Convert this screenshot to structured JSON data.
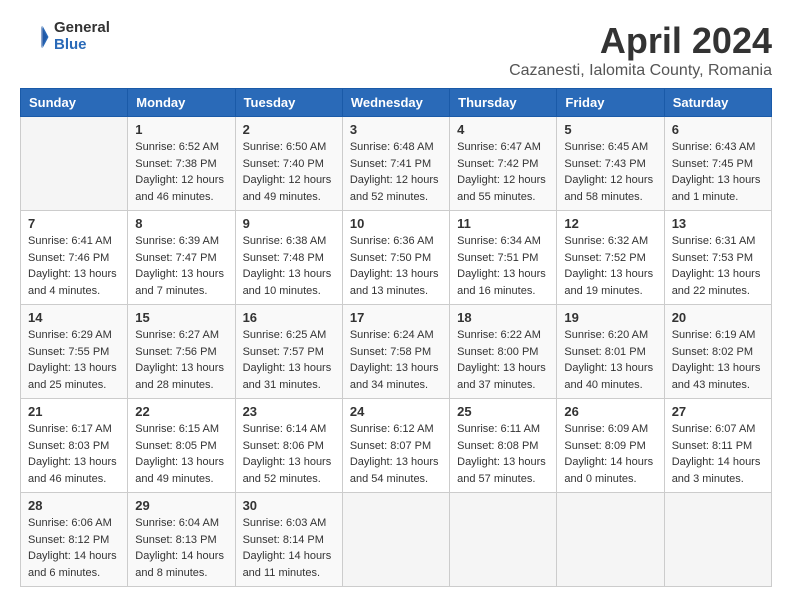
{
  "logo": {
    "general": "General",
    "blue": "Blue"
  },
  "title": "April 2024",
  "subtitle": "Cazanesti, Ialomita County, Romania",
  "days_of_week": [
    "Sunday",
    "Monday",
    "Tuesday",
    "Wednesday",
    "Thursday",
    "Friday",
    "Saturday"
  ],
  "weeks": [
    [
      {
        "day": "",
        "info": ""
      },
      {
        "day": "1",
        "info": "Sunrise: 6:52 AM\nSunset: 7:38 PM\nDaylight: 12 hours\nand 46 minutes."
      },
      {
        "day": "2",
        "info": "Sunrise: 6:50 AM\nSunset: 7:40 PM\nDaylight: 12 hours\nand 49 minutes."
      },
      {
        "day": "3",
        "info": "Sunrise: 6:48 AM\nSunset: 7:41 PM\nDaylight: 12 hours\nand 52 minutes."
      },
      {
        "day": "4",
        "info": "Sunrise: 6:47 AM\nSunset: 7:42 PM\nDaylight: 12 hours\nand 55 minutes."
      },
      {
        "day": "5",
        "info": "Sunrise: 6:45 AM\nSunset: 7:43 PM\nDaylight: 12 hours\nand 58 minutes."
      },
      {
        "day": "6",
        "info": "Sunrise: 6:43 AM\nSunset: 7:45 PM\nDaylight: 13 hours\nand 1 minute."
      }
    ],
    [
      {
        "day": "7",
        "info": "Sunrise: 6:41 AM\nSunset: 7:46 PM\nDaylight: 13 hours\nand 4 minutes."
      },
      {
        "day": "8",
        "info": "Sunrise: 6:39 AM\nSunset: 7:47 PM\nDaylight: 13 hours\nand 7 minutes."
      },
      {
        "day": "9",
        "info": "Sunrise: 6:38 AM\nSunset: 7:48 PM\nDaylight: 13 hours\nand 10 minutes."
      },
      {
        "day": "10",
        "info": "Sunrise: 6:36 AM\nSunset: 7:50 PM\nDaylight: 13 hours\nand 13 minutes."
      },
      {
        "day": "11",
        "info": "Sunrise: 6:34 AM\nSunset: 7:51 PM\nDaylight: 13 hours\nand 16 minutes."
      },
      {
        "day": "12",
        "info": "Sunrise: 6:32 AM\nSunset: 7:52 PM\nDaylight: 13 hours\nand 19 minutes."
      },
      {
        "day": "13",
        "info": "Sunrise: 6:31 AM\nSunset: 7:53 PM\nDaylight: 13 hours\nand 22 minutes."
      }
    ],
    [
      {
        "day": "14",
        "info": "Sunrise: 6:29 AM\nSunset: 7:55 PM\nDaylight: 13 hours\nand 25 minutes."
      },
      {
        "day": "15",
        "info": "Sunrise: 6:27 AM\nSunset: 7:56 PM\nDaylight: 13 hours\nand 28 minutes."
      },
      {
        "day": "16",
        "info": "Sunrise: 6:25 AM\nSunset: 7:57 PM\nDaylight: 13 hours\nand 31 minutes."
      },
      {
        "day": "17",
        "info": "Sunrise: 6:24 AM\nSunset: 7:58 PM\nDaylight: 13 hours\nand 34 minutes."
      },
      {
        "day": "18",
        "info": "Sunrise: 6:22 AM\nSunset: 8:00 PM\nDaylight: 13 hours\nand 37 minutes."
      },
      {
        "day": "19",
        "info": "Sunrise: 6:20 AM\nSunset: 8:01 PM\nDaylight: 13 hours\nand 40 minutes."
      },
      {
        "day": "20",
        "info": "Sunrise: 6:19 AM\nSunset: 8:02 PM\nDaylight: 13 hours\nand 43 minutes."
      }
    ],
    [
      {
        "day": "21",
        "info": "Sunrise: 6:17 AM\nSunset: 8:03 PM\nDaylight: 13 hours\nand 46 minutes."
      },
      {
        "day": "22",
        "info": "Sunrise: 6:15 AM\nSunset: 8:05 PM\nDaylight: 13 hours\nand 49 minutes."
      },
      {
        "day": "23",
        "info": "Sunrise: 6:14 AM\nSunset: 8:06 PM\nDaylight: 13 hours\nand 52 minutes."
      },
      {
        "day": "24",
        "info": "Sunrise: 6:12 AM\nSunset: 8:07 PM\nDaylight: 13 hours\nand 54 minutes."
      },
      {
        "day": "25",
        "info": "Sunrise: 6:11 AM\nSunset: 8:08 PM\nDaylight: 13 hours\nand 57 minutes."
      },
      {
        "day": "26",
        "info": "Sunrise: 6:09 AM\nSunset: 8:09 PM\nDaylight: 14 hours\nand 0 minutes."
      },
      {
        "day": "27",
        "info": "Sunrise: 6:07 AM\nSunset: 8:11 PM\nDaylight: 14 hours\nand 3 minutes."
      }
    ],
    [
      {
        "day": "28",
        "info": "Sunrise: 6:06 AM\nSunset: 8:12 PM\nDaylight: 14 hours\nand 6 minutes."
      },
      {
        "day": "29",
        "info": "Sunrise: 6:04 AM\nSunset: 8:13 PM\nDaylight: 14 hours\nand 8 minutes."
      },
      {
        "day": "30",
        "info": "Sunrise: 6:03 AM\nSunset: 8:14 PM\nDaylight: 14 hours\nand 11 minutes."
      },
      {
        "day": "",
        "info": ""
      },
      {
        "day": "",
        "info": ""
      },
      {
        "day": "",
        "info": ""
      },
      {
        "day": "",
        "info": ""
      }
    ]
  ]
}
